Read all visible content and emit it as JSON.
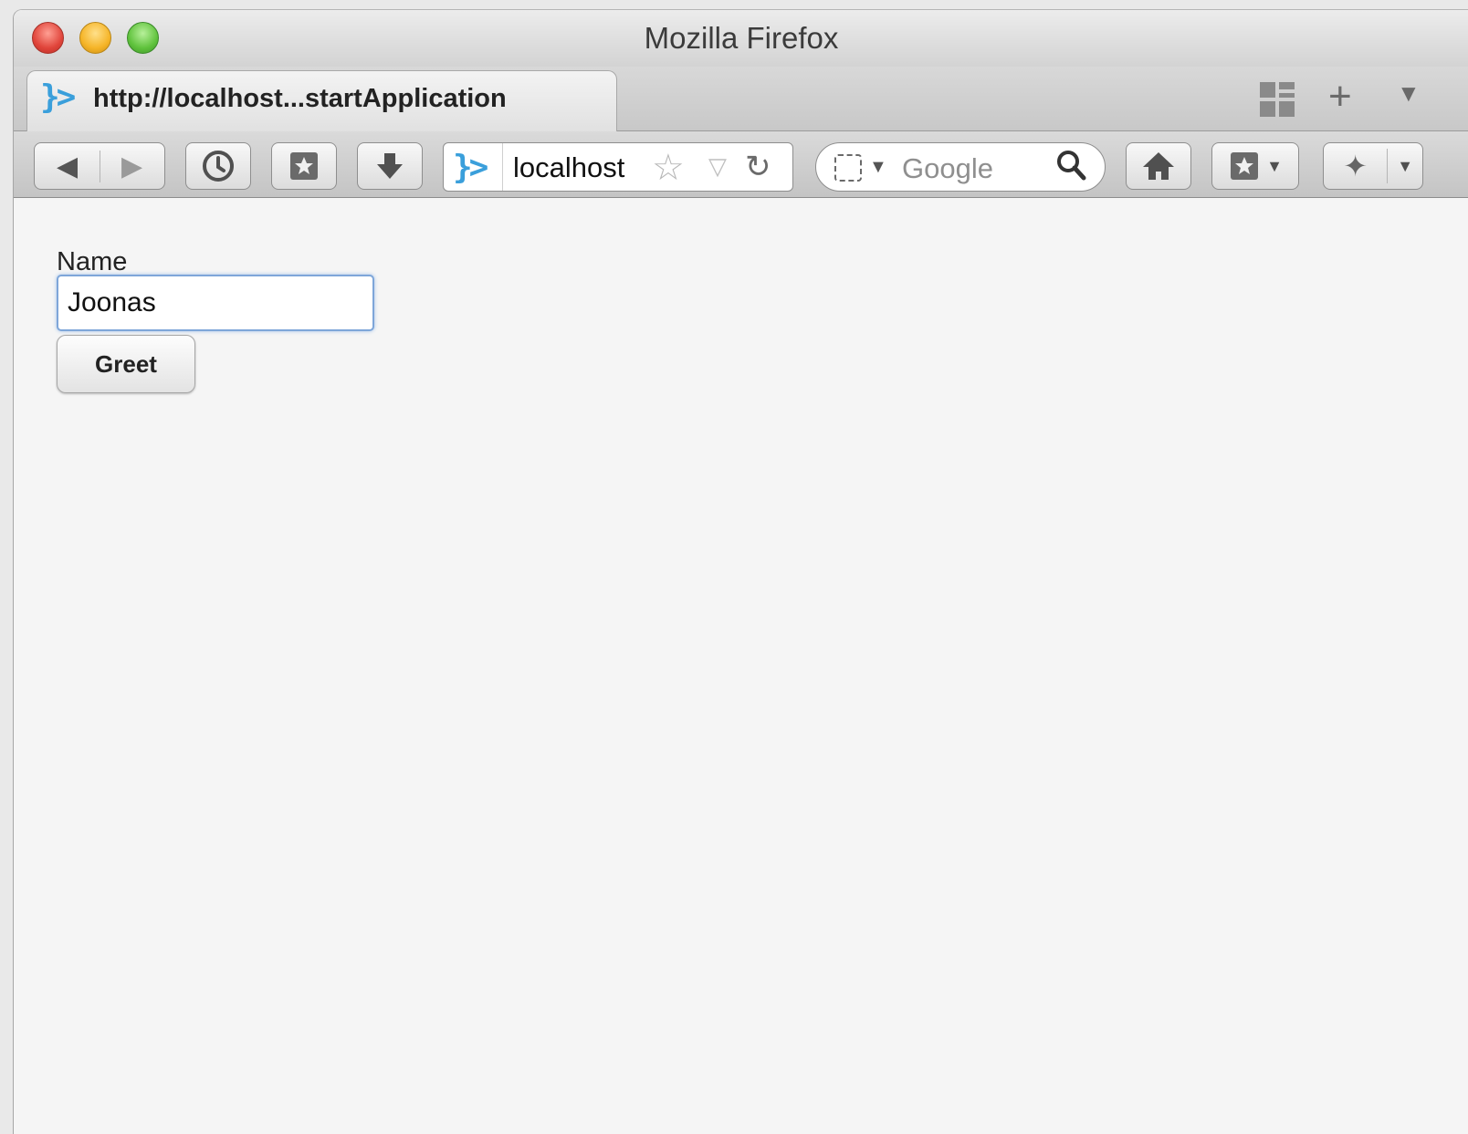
{
  "window": {
    "title": "Mozilla Firefox"
  },
  "tab": {
    "title": "http://localhost...startApplication",
    "favicon": "}>"
  },
  "tabstrip": {
    "new_tab_label": "+"
  },
  "navigation": {
    "url": "localhost",
    "search_placeholder": "Google",
    "url_favicon": "}>"
  },
  "page": {
    "name_label": "Name",
    "name_value": "Joonas",
    "greet_label": "Greet"
  },
  "colors": {
    "accent": "#3a9fdb",
    "focus_border": "#7ea6d9",
    "content_bg": "#f5f5f5"
  }
}
